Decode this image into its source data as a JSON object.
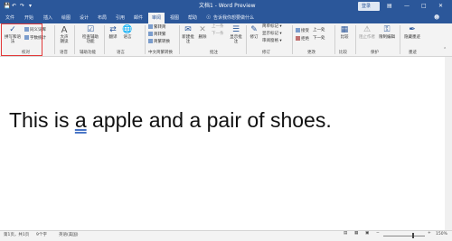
{
  "window": {
    "title": "文档1 - Word Preview",
    "sign_in": "登录"
  },
  "tabs": [
    "文件",
    "开始",
    "插入",
    "绘图",
    "设计",
    "布局",
    "引用",
    "邮件",
    "审阅",
    "视图",
    "帮助",
    "告诉我你想要做什么"
  ],
  "ribbon": {
    "proofing": {
      "spell": "拼写和语法",
      "wordcount_a": "同义词库",
      "wordcount_b": "字数统计",
      "label": "校对"
    },
    "speech": {
      "read": "大声朗读",
      "label": "语音"
    },
    "accessibility": {
      "check": "检查辅助功能",
      "label": "辅助功能"
    },
    "language": {
      "translate": "翻译",
      "lang": "语言",
      "label": "语言"
    },
    "chinese": {
      "a": "繁转简",
      "b": "简转繁",
      "c": "简繁转换",
      "label": "中文简繁转换"
    },
    "comments": {
      "new": "新建批注",
      "delete": "删除",
      "prev": "上一条",
      "next": "下一条",
      "show": "显示批注",
      "label": "批注"
    },
    "tracking": {
      "track": "修订",
      "simple": "简单标记",
      "show": "显示标记",
      "pane": "审阅窗格",
      "label": "修订"
    },
    "changes": {
      "accept": "接受",
      "reject": "拒绝",
      "prev": "上一处",
      "next": "下一处",
      "label": "更改"
    },
    "compare": {
      "compare": "比较",
      "label": "比较"
    },
    "protect": {
      "block": "阻止作者",
      "restrict": "限制编辑",
      "label": "保护"
    },
    "ink": {
      "hide": "隐藏墨迹",
      "label": "墨迹"
    }
  },
  "document": {
    "text_before": "This is ",
    "text_error": "a",
    "text_after": " apple and a pair of shoes."
  },
  "status": {
    "page": "第1页，共1页",
    "words": "9个字",
    "lang": "英语(美国)",
    "zoom": "150%"
  },
  "colors": {
    "accent": "#2b579a",
    "highlight": "#e33a3a"
  }
}
